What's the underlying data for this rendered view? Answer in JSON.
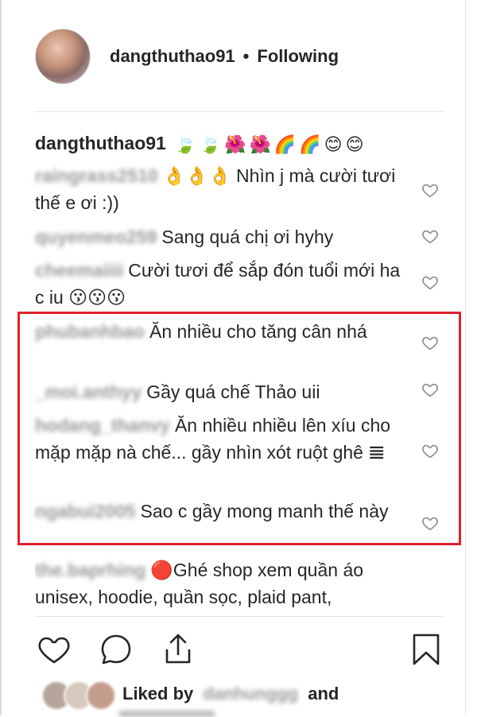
{
  "header": {
    "username": "dangthuthao91",
    "separator": "•",
    "follow_status": "Following"
  },
  "caption": {
    "username": "dangthuthao91",
    "emojis": [
      "🍃",
      "🍃",
      "🌺",
      "🌺",
      "🌈",
      "🌈",
      "😊",
      "😊"
    ]
  },
  "comments": [
    {
      "username": "raingrass2510",
      "text": "👌👌👌 Nhìn j mà cười tươi thế e ơi :))"
    },
    {
      "username": "quyenmeo259",
      "text": "Sang quá chị ơi hyhy"
    },
    {
      "username": "cheemaiiii",
      "text": "Cười tươi để sắp đón tuổi mới ha c iu 😗😗😗"
    },
    {
      "username": "phubanhbao",
      "text": "Ăn nhiều cho tăng cân nhá"
    },
    {
      "username": "_moi.anthyy",
      "text": "Gầy quá chế Thảo uii"
    },
    {
      "username": "hodang_thanvy",
      "text": "Ăn nhiều nhiều lên xíu cho mặp mặp nà chế... gầy nhìn xót ruột ghê 𝌆"
    },
    {
      "username": "ngabui2005",
      "text": "Sao c gầy mong manh thế này"
    },
    {
      "username": "the.baprhing",
      "text": "🔴Ghé shop xem quần áo unisex, hoodie, quần sọc, plaid pant,"
    }
  ],
  "likes": {
    "prefix": "Liked by",
    "user": "danhunggg",
    "suffix": "and"
  },
  "icons": {
    "like": "heart-icon",
    "comment": "comment-icon",
    "share": "share-icon",
    "save": "bookmark-icon"
  },
  "colors": {
    "highlight": "#e0202a",
    "text": "#262626",
    "muted": "#9a9a9a"
  }
}
